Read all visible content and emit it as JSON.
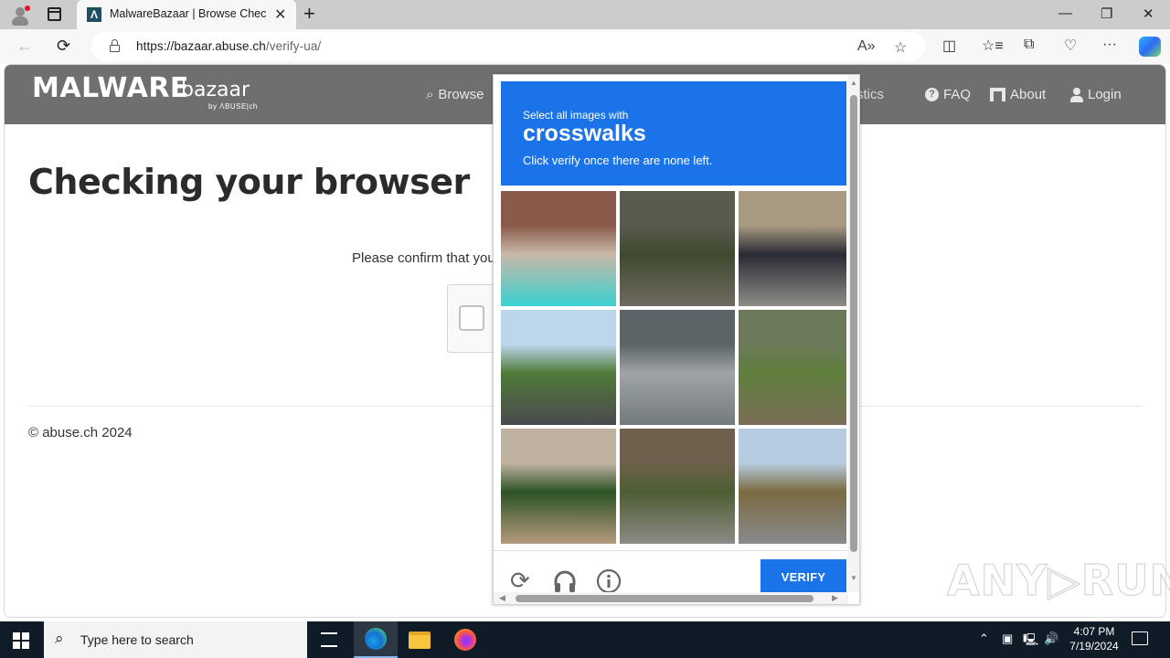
{
  "browser": {
    "tab_title": "MalwareBazaar | Browse Checking your browser",
    "tab_favicon": "Λ",
    "url_host": "https://bazaar.abuse.ch",
    "url_path": "/verify-ua/",
    "icons": {
      "back": "←",
      "refresh": "⟳",
      "read_aloud": "A»",
      "favorite": "☆",
      "split": "◫",
      "favorites": "☆≡",
      "collections": "⧉",
      "health": "♡",
      "more": "···",
      "minimize": "—",
      "restore": "❐",
      "close": "✕",
      "new_tab": "+",
      "tab_close": "✕"
    }
  },
  "site": {
    "logo_main": "MALWARE",
    "logo_sub": "bazaar",
    "logo_by": "by ΛBUSE|ch",
    "nav": [
      {
        "label": "Browse",
        "icon": "search-icon",
        "glyph": "🔍"
      },
      {
        "label": "Statistics",
        "icon": "chart-icon",
        "glyph": ""
      },
      {
        "label": "FAQ",
        "icon": "question-circle-icon",
        "glyph": "?"
      },
      {
        "label": "About",
        "icon": "building-icon",
        "glyph": "⛩"
      },
      {
        "label": "Login",
        "icon": "user-icon",
        "glyph": "👤"
      }
    ],
    "heading": "Checking your browser",
    "confirm_text": "Please confirm that you are not a robot",
    "footer": "© abuse.ch 2024"
  },
  "captcha": {
    "instruction_top": "Select all images with",
    "target": "crosswalks",
    "instruction_bottom": "Click verify once there are none left.",
    "tiles": [
      {
        "label": "storefront with person",
        "colors": [
          "#8b5a4a",
          "#c8b8a8",
          "#3ad1d0"
        ]
      },
      {
        "label": "tractor on road",
        "colors": [
          "#5a5a4e",
          "#3d4a2e",
          "#6f6a60"
        ]
      },
      {
        "label": "parked motorcycles",
        "colors": [
          "#a89a80",
          "#2a2a35",
          "#8f8c86"
        ]
      },
      {
        "label": "tree-lined street with cars",
        "colors": [
          "#bcd6ec",
          "#4f7a38",
          "#4a4a4e"
        ]
      },
      {
        "label": "corrugated metal building",
        "colors": [
          "#5c6468",
          "#9ea4a8",
          "#737a7e"
        ]
      },
      {
        "label": "field with bicycle",
        "colors": [
          "#6c7a5a",
          "#5f7e3c",
          "#7a6e58"
        ]
      },
      {
        "label": "hedge and wall",
        "colors": [
          "#c0b2a0",
          "#2e5226",
          "#b49a7c"
        ]
      },
      {
        "label": "posts with chains by road",
        "colors": [
          "#6e604c",
          "#4d5e34",
          "#8d8a86"
        ]
      },
      {
        "label": "roadside shop",
        "colors": [
          "#b6cce0",
          "#7a6a40",
          "#8a8a8e"
        ]
      }
    ],
    "verify_label": "VERIFY",
    "icons": {
      "reload": "⟳",
      "audio": "🎧",
      "info": "ⓘ"
    }
  },
  "watermark": "ANY▷RUN",
  "taskbar": {
    "search_placeholder": "Type here to search",
    "time": "4:07 PM",
    "date": "7/19/2024"
  }
}
